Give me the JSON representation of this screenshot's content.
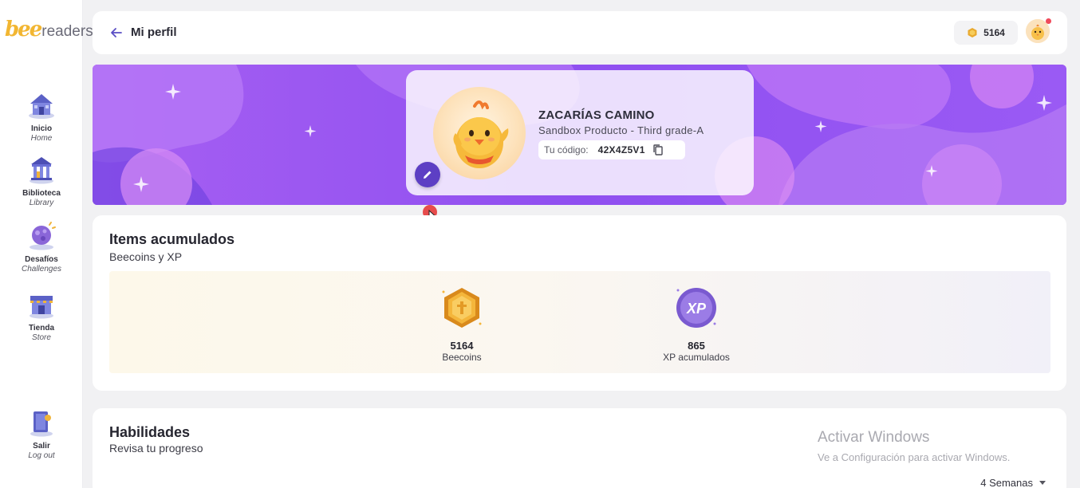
{
  "brand": {
    "logo_bee": "bee",
    "logo_readers": "readers",
    "accent": "#f2b632"
  },
  "sidebar": {
    "items": [
      {
        "label": "Inicio",
        "sublabel": "Home",
        "icon": "house-icon"
      },
      {
        "label": "Biblioteca",
        "sublabel": "Library",
        "icon": "library-icon"
      },
      {
        "label": "Desafíos",
        "sublabel": "Challenges",
        "icon": "challenges-icon"
      },
      {
        "label": "Tienda",
        "sublabel": "Store",
        "icon": "store-icon"
      }
    ],
    "logout": {
      "label": "Salir",
      "sublabel": "Log out",
      "icon": "logout-icon"
    }
  },
  "header": {
    "title": "Mi perfil",
    "beecoins": "5164"
  },
  "profile": {
    "name": "ZACARÍAS CAMINO",
    "class": "Sandbox Producto - Third grade-A",
    "code_label": "Tu código:",
    "code_value": "42X4Z5V1",
    "banner_color": "#9a55f0"
  },
  "items": {
    "title": "Items acumulados",
    "subtitle": "Beecoins y XP",
    "stats": [
      {
        "value": "5164",
        "label": "Beecoins",
        "icon": "beecoin-icon"
      },
      {
        "value": "865",
        "label": "XP acumulados",
        "icon": "xp-icon"
      }
    ]
  },
  "skills": {
    "title": "Habilidades",
    "subtitle": "Revisa tu progreso",
    "period": "4 Semanas"
  },
  "watermark": {
    "line1": "Activar Windows",
    "line2": "Ve a Configuración para activar Windows."
  }
}
